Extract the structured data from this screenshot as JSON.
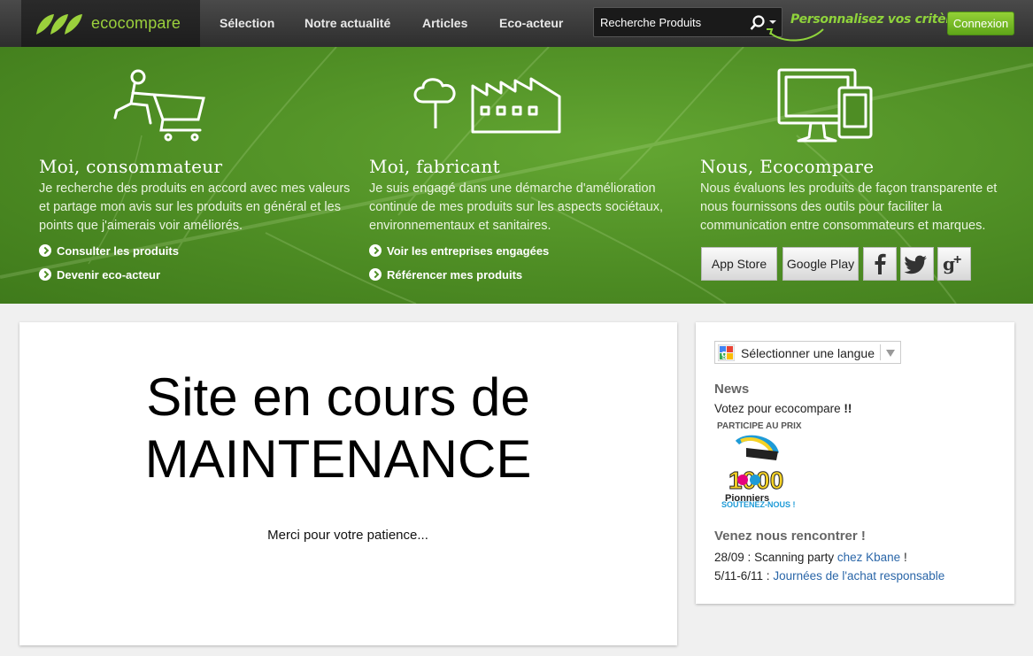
{
  "brand": {
    "name": "ecocompare"
  },
  "nav": {
    "items": [
      "Sélection",
      "Notre actualité",
      "Articles",
      "Eco-acteur"
    ],
    "search_value": "Recherche Produits",
    "personalize": "Personnalisez vos critères",
    "login": "Connexion"
  },
  "hero": {
    "columns": [
      {
        "title": "Moi, consommateur",
        "text": "Je recherche des produits en accord avec mes valeurs et partage mon avis sur les produits en général et les points que j'aimerais voir améliorés.",
        "links": [
          "Consulter les produits",
          "Devenir eco-acteur"
        ],
        "icon": "shopper-cart-icon"
      },
      {
        "title": "Moi, fabricant",
        "text": "Je suis engagé dans une démarche d'amélioration continue de mes produits sur les aspects sociétaux, environnementaux et sanitaires.",
        "links": [
          "Voir les entreprises engagées",
          "Référencer mes produits"
        ],
        "icon": "factory-icon"
      },
      {
        "title": "Nous, Ecocompare",
        "text": "Nous évaluons les produits de façon transparente et nous fournissons des outils pour faciliter la communication entre consommateurs et marques.",
        "icon": "devices-icon"
      }
    ],
    "stores": [
      "App Store",
      "Google Play"
    ],
    "social": [
      "facebook-icon",
      "twitter-icon",
      "google-plus-icon"
    ]
  },
  "main": {
    "title_line1": "Site en cours de",
    "title_line2": "MAINTENANCE",
    "subtitle": "Merci pour votre patience..."
  },
  "sidebar": {
    "language_select": "Sélectionner une langue",
    "news_heading": "News",
    "vote_text": "Votez pour ecocompare",
    "vote_excl": "!!",
    "prize_label": "PARTICIPE AU PRIX",
    "prize_badge_text": "1000",
    "prize_badge_name": "Pionniers",
    "prize_cta": "SOUTENEZ-NOUS !",
    "meet_heading": "Venez nous rencontrer !",
    "events": [
      {
        "date": "28/09 :",
        "text": "Scanning party",
        "link": "chez Kbane",
        "suffix": "!"
      },
      {
        "date": "5/11-6/11 :",
        "text": "",
        "link": "Journées de l'achat responsable",
        "suffix": ""
      }
    ]
  },
  "colors": {
    "accent": "#8fd33b",
    "hero_green": "#4e8d24",
    "link": "#2a66a8"
  }
}
